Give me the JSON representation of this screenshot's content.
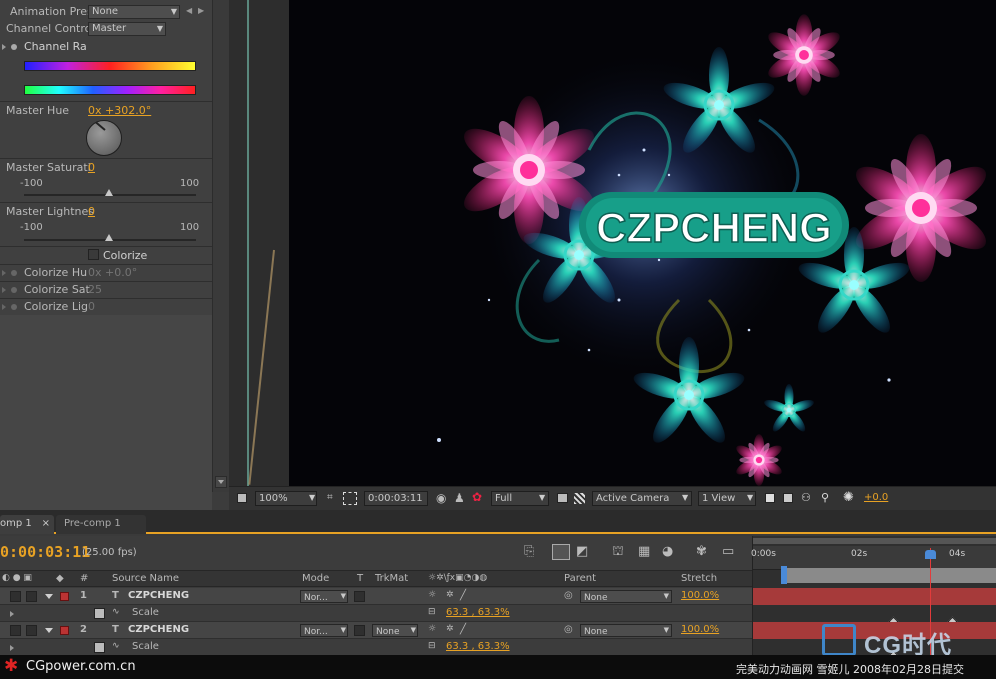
{
  "effect_controls": {
    "animation_preset_label": "Animation Pres",
    "animation_preset_value": "None",
    "channel_control_label": "Channel Control",
    "channel_control_value": "Master",
    "channel_range_label": "Channel Ra",
    "master_hue_label": "Master Hue",
    "master_hue_value": "0x +302.0°",
    "master_saturation_label": "Master Saturati",
    "master_saturation_value": "0",
    "master_saturation_min": "-100",
    "master_saturation_max": "100",
    "master_lightness_label": "Master Lightnes",
    "master_lightness_value": "0",
    "master_lightness_min": "-100",
    "master_lightness_max": "100",
    "colorize_label": "Colorize",
    "colorize_hue_label": "Colorize Hu",
    "colorize_hue_value": "0x +0.0°",
    "colorize_sat_label": "Colorize Sat",
    "colorize_sat_value": "25",
    "colorize_lig_label": "Colorize Lig",
    "colorize_lig_value": "0"
  },
  "canvas": {
    "title_text": "CZPCHENG"
  },
  "viewer_toolbar": {
    "zoom": "100%",
    "timecode": "0:00:03:11",
    "resolution": "Full",
    "camera": "Active Camera",
    "view_layout": "1 View",
    "exposure": "+0.0"
  },
  "timeline": {
    "tabs": [
      "omp 1",
      "Pre-comp 1"
    ],
    "current_time": "0:00:03:11",
    "fps": "(25.00 fps)",
    "columns": {
      "number": "#",
      "source_name": "Source Name",
      "mode": "Mode",
      "t": "T",
      "trkmat": "TrkMat",
      "parent": "Parent",
      "stretch": "Stretch"
    },
    "layers": [
      {
        "number": "1",
        "name": "CZPCHENG",
        "mode": "Nor...",
        "trkmat": "",
        "parent": "None",
        "stretch": "100.0%",
        "property": "Scale",
        "property_value": "63.3 , 63.3%"
      },
      {
        "number": "2",
        "name": "CZPCHENG",
        "mode": "Nor...",
        "trkmat": "None",
        "parent": "None",
        "stretch": "100.0%",
        "property": "Scale",
        "property_value": "63.3 , 63.3%"
      }
    ],
    "ruler_labels": [
      "0:00s",
      "02s",
      "04s"
    ]
  },
  "footer": {
    "site": "CGpower.com.cn",
    "caption": "完美动力动画网 雪姬儿 2008年02月28日提交",
    "logo_text": "CG时代"
  },
  "colors": {
    "accent_orange": "#e8a224",
    "layer_red": "#a63a3a",
    "cti_red": "#e23b3b",
    "logo_blue": "#3f86c9"
  }
}
